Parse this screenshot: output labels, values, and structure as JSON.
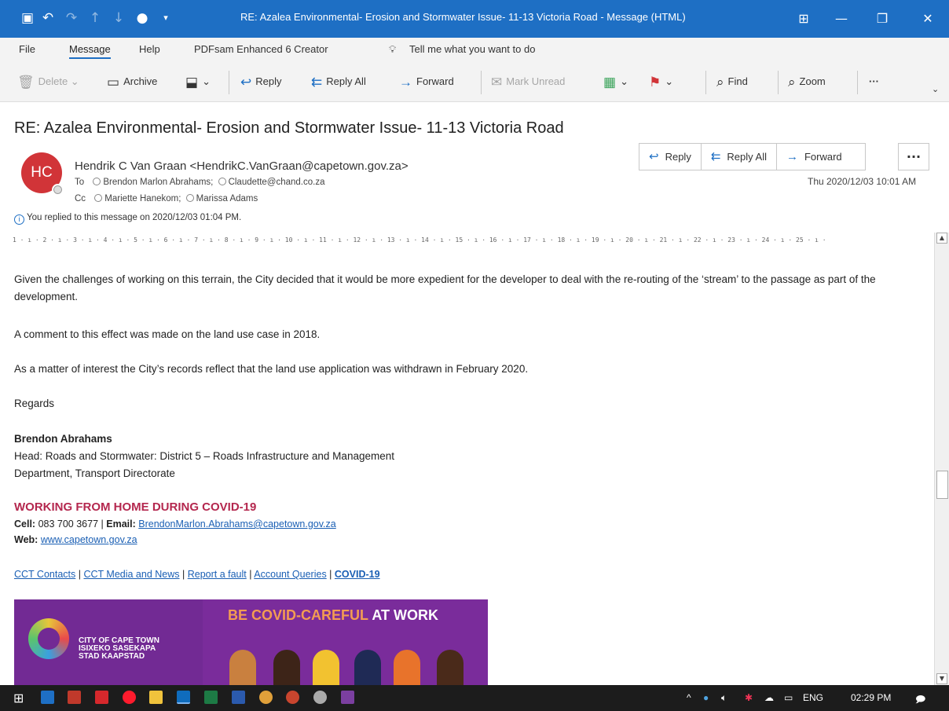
{
  "window": {
    "title": "RE: Azalea Environmental- Erosion and Stormwater Issue- 11-13 Victoria Road  -  Message (HTML)"
  },
  "menu": {
    "items": [
      "File",
      "Message",
      "Help",
      "PDFsam Enhanced 6 Creator"
    ],
    "active": "Message",
    "tell_me": "Tell me what you want to do"
  },
  "ribbon": {
    "delete": "Delete",
    "archive": "Archive",
    "reply": "Reply",
    "reply_all": "Reply All",
    "forward": "Forward",
    "mark_unread": "Mark Unread",
    "find": "Find",
    "zoom": "Zoom"
  },
  "message": {
    "subject": "RE: Azalea Environmental- Erosion and Stormwater Issue- 11-13 Victoria Road",
    "avatar_initials": "HC",
    "sender": "Hendrik C Van Graan <HendrikC.VanGraan@capetown.gov.za>",
    "to_label": "To",
    "to": [
      "Brendon Marlon Abrahams;",
      "Claudette@chand.co.za"
    ],
    "cc_label": "Cc",
    "cc": [
      "Mariette Hanekom;",
      "Marissa Adams"
    ],
    "info": "You replied to this message on 2020/12/03 01:04 PM.",
    "date": "Thu 2020/12/03 10:01 AM",
    "actions": {
      "reply": "Reply",
      "reply_all": "Reply All",
      "forward": "Forward"
    }
  },
  "ruler": "1 · ı · 2 · ı · 3 · ı · 4 · ı · 5 · ı · 6 · ı · 7 · ı · 8 · ı · 9 · ı · 10 · ı · 11 · ı · 12 · ı · 13 · ı · 14 · ı · 15 · ı · 16 · ı · 17 · ı · 18 · ı · 19 · ı · 20 · ı · 21 · ı · 22 · ı · 23 · ı · 24 · ı · 25 · ı ·",
  "body": {
    "p1": "Given the challenges of working on this terrain, the City decided that it would be more expedient for the developer to deal with the re-routing  of the ‘stream’ to the passage as part of the development.",
    "p2": "A comment to this effect was made on the land use case in 2018.",
    "p3": "As a matter of interest the City’s records reflect that the land use application was withdrawn in February 2020.",
    "regards": "Regards",
    "sig_name": "Brendon Abrahams",
    "sig_title": "Head: Roads and Stormwater: District 5 – Roads Infrastructure and Management",
    "sig_dept": "Department, Transport Directorate",
    "covid_heading": "WORKING FROM HOME DURING COVID-19",
    "cell_label": "Cell:",
    "cell": "083 700 3677",
    "email_label": "Email:",
    "email": "BrendonMarlon.Abrahams@capetown.gov.za",
    "web_label": "Web:",
    "web": "www.capetown.gov.za",
    "links": [
      "CCT Contacts",
      "CCT Media and News",
      "Report a fault",
      "Account Queries",
      "COVID-19"
    ]
  },
  "banner": {
    "org_line1": "CITY OF CAPE TOWN",
    "org_line2": "ISIXEKO SASEKAPA",
    "org_line3": "STAD KAAPSTAD",
    "title_a": "BE COVID-CAREFUL",
    "title_b": " AT WORK"
  },
  "taskbar": {
    "lang": "ENG",
    "time": "02:29 PM"
  }
}
